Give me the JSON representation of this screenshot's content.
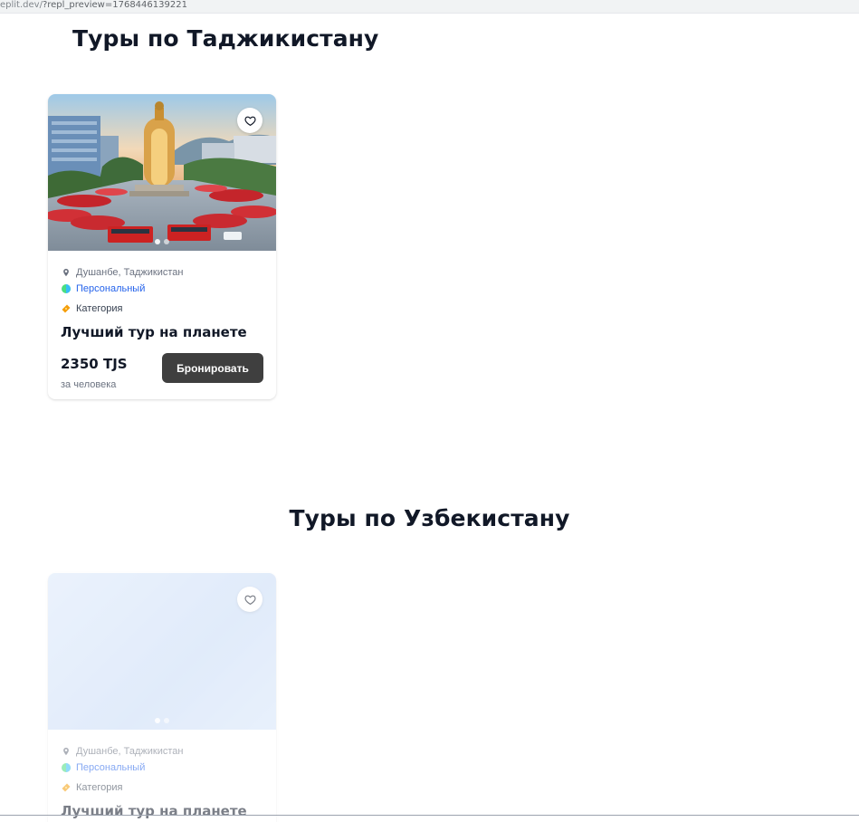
{
  "browser": {
    "url_prefix": "eplit.dev/",
    "url_rest": "?repl_preview=1768446139221"
  },
  "sections": [
    {
      "title": "Туры по Таджикистану",
      "card": {
        "location": "Душанбе, Таджикистан",
        "type": "Персональный",
        "category": "Категория",
        "title": "Лучший тур на планете",
        "price": "2350 TJS",
        "price_note": "за человека",
        "book_label": "Бронировать",
        "image_dots": 2
      }
    },
    {
      "title": "Туры по Узбекистану",
      "card": {
        "location": "Душанбе, Таджикистан",
        "type": "Персональный",
        "category": "Категория",
        "title": "Лучший тур на планете",
        "image_dots": 2
      }
    }
  ],
  "colors": {
    "type_link": "#2563eb",
    "book_button": "#3f3f3f",
    "heading": "#111827"
  },
  "icons": {
    "favorite": "heart-icon",
    "location": "map-pin-icon",
    "type": "globe-icon",
    "category": "ticket-icon"
  }
}
